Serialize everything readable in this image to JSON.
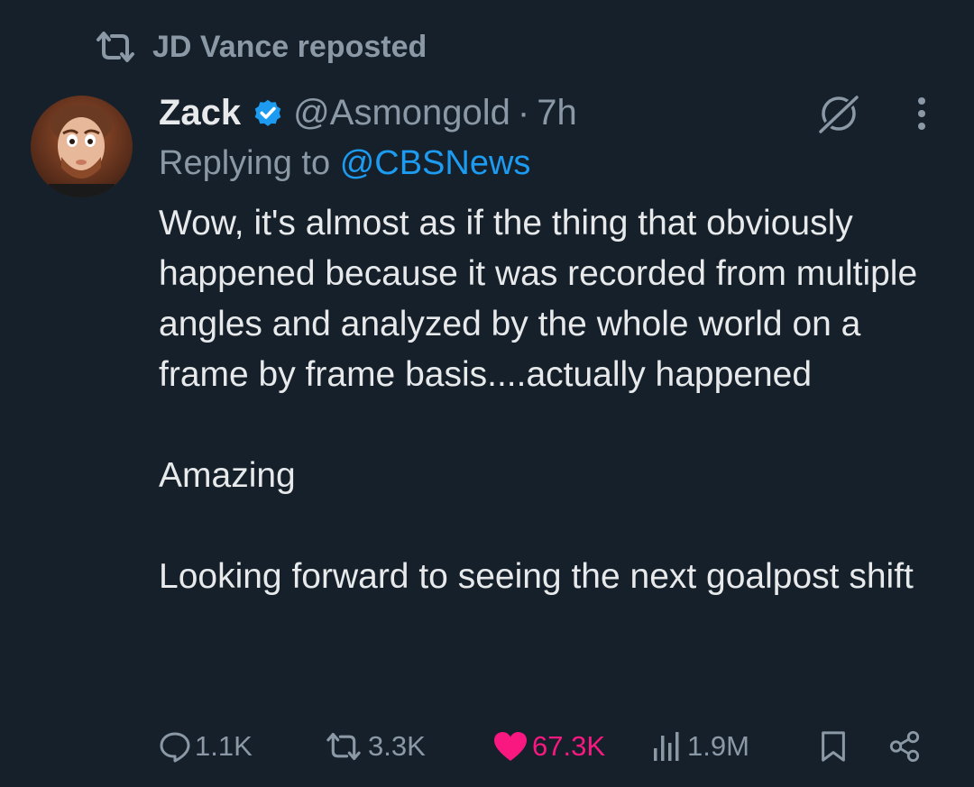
{
  "repost_header": {
    "label": "JD Vance reposted"
  },
  "tweet": {
    "author": {
      "display_name": "Zack",
      "handle": "@Asmongold",
      "verified": true
    },
    "separator": "·",
    "time": "7h",
    "replying_prefix": "Replying to",
    "replying_to": "@CBSNews",
    "paragraphs": [
      "Wow, it's almost as if the thing that obviously happened because it was recorded from multiple angles and analyzed by the whole world on a frame by frame basis....actually happened",
      "Amazing",
      "Looking forward to seeing the next goalpost shift"
    ]
  },
  "metrics": {
    "replies": "1.1K",
    "reposts": "3.3K",
    "likes": "67.3K",
    "views": "1.9M"
  },
  "colors": {
    "background": "#15202b",
    "text": "#e7e9ea",
    "muted": "#8b98a5",
    "accent": "#1d9bf0",
    "like": "#f91880"
  },
  "icons": {
    "repost": "repost-icon",
    "verified": "verified-badge-icon",
    "grok": "grok-icon",
    "more": "more-icon",
    "reply": "reply-icon",
    "like": "heart-icon",
    "views": "views-icon",
    "bookmark": "bookmark-icon",
    "share": "share-icon"
  }
}
